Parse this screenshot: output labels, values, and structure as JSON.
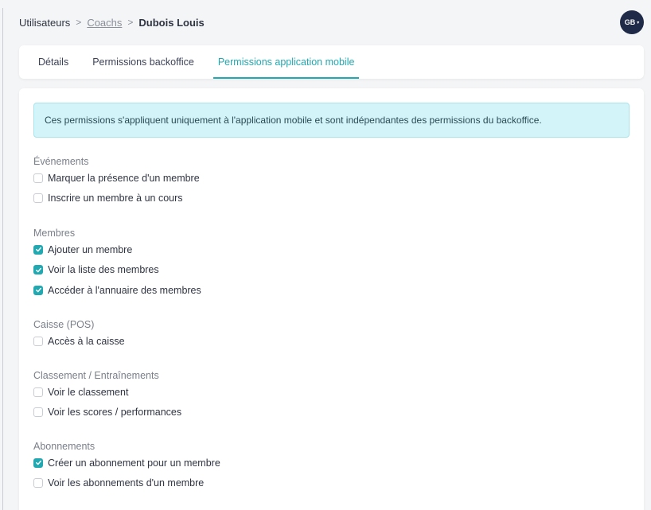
{
  "breadcrumb": {
    "root": "Utilisateurs",
    "sep": ">",
    "middle": "Coachs",
    "current": "Dubois Louis"
  },
  "user": {
    "initials": "GB",
    "caret": "▾"
  },
  "tabs": [
    {
      "label": "Détails",
      "active": false
    },
    {
      "label": "Permissions backoffice",
      "active": false
    },
    {
      "label": "Permissions application mobile",
      "active": true
    }
  ],
  "notice": "Ces permissions s'appliquent uniquement à l'application mobile et sont indépendantes des permissions du backoffice.",
  "sections": [
    {
      "title": "Événements",
      "items": [
        {
          "label": "Marquer la présence d'un membre",
          "checked": false
        },
        {
          "label": "Inscrire un membre à un cours",
          "checked": false
        }
      ]
    },
    {
      "title": "Membres",
      "items": [
        {
          "label": "Ajouter un membre",
          "checked": true
        },
        {
          "label": "Voir la liste des membres",
          "checked": true
        },
        {
          "label": "Accéder à l'annuaire des membres",
          "checked": true
        }
      ]
    },
    {
      "title": "Caisse (POS)",
      "items": [
        {
          "label": "Accès à la caisse",
          "checked": false
        }
      ]
    },
    {
      "title": "Classement / Entraînements",
      "items": [
        {
          "label": "Voir le classement",
          "checked": false
        },
        {
          "label": "Voir les scores / performances",
          "checked": false
        }
      ]
    },
    {
      "title": "Abonnements",
      "items": [
        {
          "label": "Créer un abonnement pour un membre",
          "checked": true
        },
        {
          "label": "Voir les abonnements d'un membre",
          "checked": false
        }
      ]
    }
  ],
  "colors": {
    "accent": "#22a8b0",
    "avatar_bg": "#1f2a48",
    "notice_bg": "#d3f4f8"
  }
}
